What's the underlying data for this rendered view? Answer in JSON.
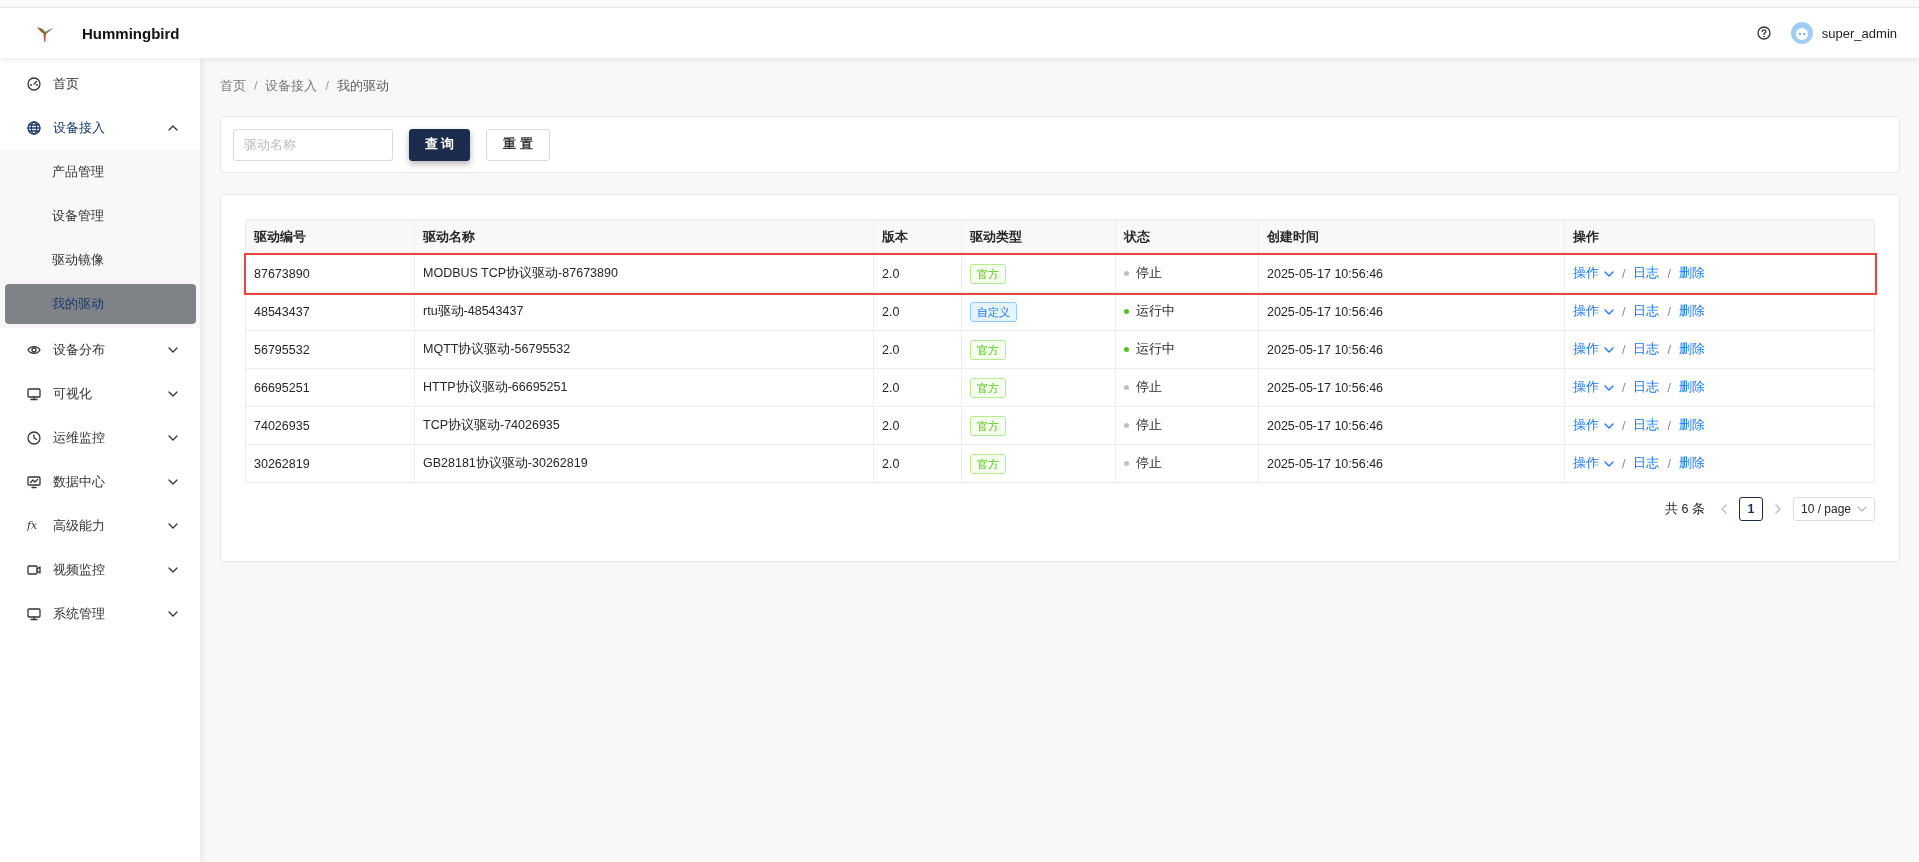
{
  "header": {
    "app_name": "Hummingbird",
    "user_name": "super_admin"
  },
  "sidebar": {
    "items": [
      {
        "label": "首页",
        "selected": false
      },
      {
        "label": "设备接入",
        "expanded": true,
        "selected": true,
        "children": [
          {
            "label": "产品管理",
            "selected": false
          },
          {
            "label": "设备管理",
            "selected": false
          },
          {
            "label": "驱动镜像",
            "selected": false
          },
          {
            "label": "我的驱动",
            "selected": true
          }
        ]
      },
      {
        "label": "设备分布",
        "expanded": false,
        "selected": false
      },
      {
        "label": "可视化",
        "expanded": false,
        "selected": false
      },
      {
        "label": "运维监控",
        "expanded": false,
        "selected": false
      },
      {
        "label": "数据中心",
        "expanded": false,
        "selected": false
      },
      {
        "label": "高级能力",
        "icon_text": "fx",
        "expanded": false,
        "selected": false
      },
      {
        "label": "视频监控",
        "expanded": false,
        "selected": false
      },
      {
        "label": "系统管理",
        "expanded": false,
        "selected": false
      }
    ]
  },
  "breadcrumb": [
    {
      "label": "首页",
      "kind": "link"
    },
    {
      "label": "/",
      "kind": "separator"
    },
    {
      "label": "设备接入",
      "kind": "link"
    },
    {
      "label": "/",
      "kind": "separator"
    },
    {
      "label": "我的驱动",
      "kind": "current"
    }
  ],
  "search": {
    "placeholder": "驱动名称",
    "buttons": [
      {
        "label": "查 询",
        "kind": "primary"
      },
      {
        "label": "重 置",
        "kind": "default"
      }
    ]
  },
  "table": {
    "columns": [
      "驱动编号",
      "驱动名称",
      "版本",
      "驱动类型",
      "状态",
      "创建时间",
      "操作"
    ],
    "rows": [
      {
        "id": "87673890",
        "name": "MODBUS TCP协议驱动-87673890",
        "version": "2.0",
        "type": {
          "label": "官方",
          "kind": "official"
        },
        "status": {
          "label": "停止",
          "color": "#bfbfbf"
        },
        "created": "2025-05-17 10:56:46",
        "highlighted": true,
        "actions": [
          {
            "label": "操作",
            "kind": "dropdown"
          },
          {
            "label": "/",
            "kind": "separator"
          },
          {
            "label": "日志",
            "kind": "link"
          },
          {
            "label": "/",
            "kind": "separator"
          },
          {
            "label": "删除",
            "kind": "link"
          }
        ]
      },
      {
        "id": "48543437",
        "name": "rtu驱动-48543437",
        "version": "2.0",
        "type": {
          "label": "自定义",
          "kind": "custom"
        },
        "status": {
          "label": "运行中",
          "color": "#52c41a"
        },
        "created": "2025-05-17 10:56:46",
        "highlighted": false,
        "actions": [
          {
            "label": "操作",
            "kind": "dropdown"
          },
          {
            "label": "/",
            "kind": "separator"
          },
          {
            "label": "日志",
            "kind": "link"
          },
          {
            "label": "/",
            "kind": "separator"
          },
          {
            "label": "删除",
            "kind": "link"
          }
        ]
      },
      {
        "id": "56795532",
        "name": "MQTT协议驱动-56795532",
        "version": "2.0",
        "type": {
          "label": "官方",
          "kind": "official"
        },
        "status": {
          "label": "运行中",
          "color": "#52c41a"
        },
        "created": "2025-05-17 10:56:46",
        "highlighted": false,
        "actions": [
          {
            "label": "操作",
            "kind": "dropdown"
          },
          {
            "label": "/",
            "kind": "separator"
          },
          {
            "label": "日志",
            "kind": "link"
          },
          {
            "label": "/",
            "kind": "separator"
          },
          {
            "label": "删除",
            "kind": "link"
          }
        ]
      },
      {
        "id": "66695251",
        "name": "HTTP协议驱动-66695251",
        "version": "2.0",
        "type": {
          "label": "官方",
          "kind": "official"
        },
        "status": {
          "label": "停止",
          "color": "#bfbfbf"
        },
        "created": "2025-05-17 10:56:46",
        "highlighted": false,
        "actions": [
          {
            "label": "操作",
            "kind": "dropdown"
          },
          {
            "label": "/",
            "kind": "separator"
          },
          {
            "label": "日志",
            "kind": "link"
          },
          {
            "label": "/",
            "kind": "separator"
          },
          {
            "label": "删除",
            "kind": "link"
          }
        ]
      },
      {
        "id": "74026935",
        "name": "TCP协议驱动-74026935",
        "version": "2.0",
        "type": {
          "label": "官方",
          "kind": "official"
        },
        "status": {
          "label": "停止",
          "color": "#bfbfbf"
        },
        "created": "2025-05-17 10:56:46",
        "highlighted": false,
        "actions": [
          {
            "label": "操作",
            "kind": "dropdown"
          },
          {
            "label": "/",
            "kind": "separator"
          },
          {
            "label": "日志",
            "kind": "link"
          },
          {
            "label": "/",
            "kind": "separator"
          },
          {
            "label": "删除",
            "kind": "link"
          }
        ]
      },
      {
        "id": "30262819",
        "name": "GB28181协议驱动-30262819",
        "version": "2.0",
        "type": {
          "label": "官方",
          "kind": "official"
        },
        "status": {
          "label": "停止",
          "color": "#bfbfbf"
        },
        "created": "2025-05-17 10:56:46",
        "highlighted": false,
        "actions": [
          {
            "label": "操作",
            "kind": "dropdown"
          },
          {
            "label": "/",
            "kind": "separator"
          },
          {
            "label": "日志",
            "kind": "link"
          },
          {
            "label": "/",
            "kind": "separator"
          },
          {
            "label": "删除",
            "kind": "link"
          }
        ]
      }
    ]
  },
  "pagination": {
    "total": "共 6 条",
    "pages": [
      {
        "label": "1",
        "selected": true
      }
    ],
    "page_size": "10 / page"
  }
}
